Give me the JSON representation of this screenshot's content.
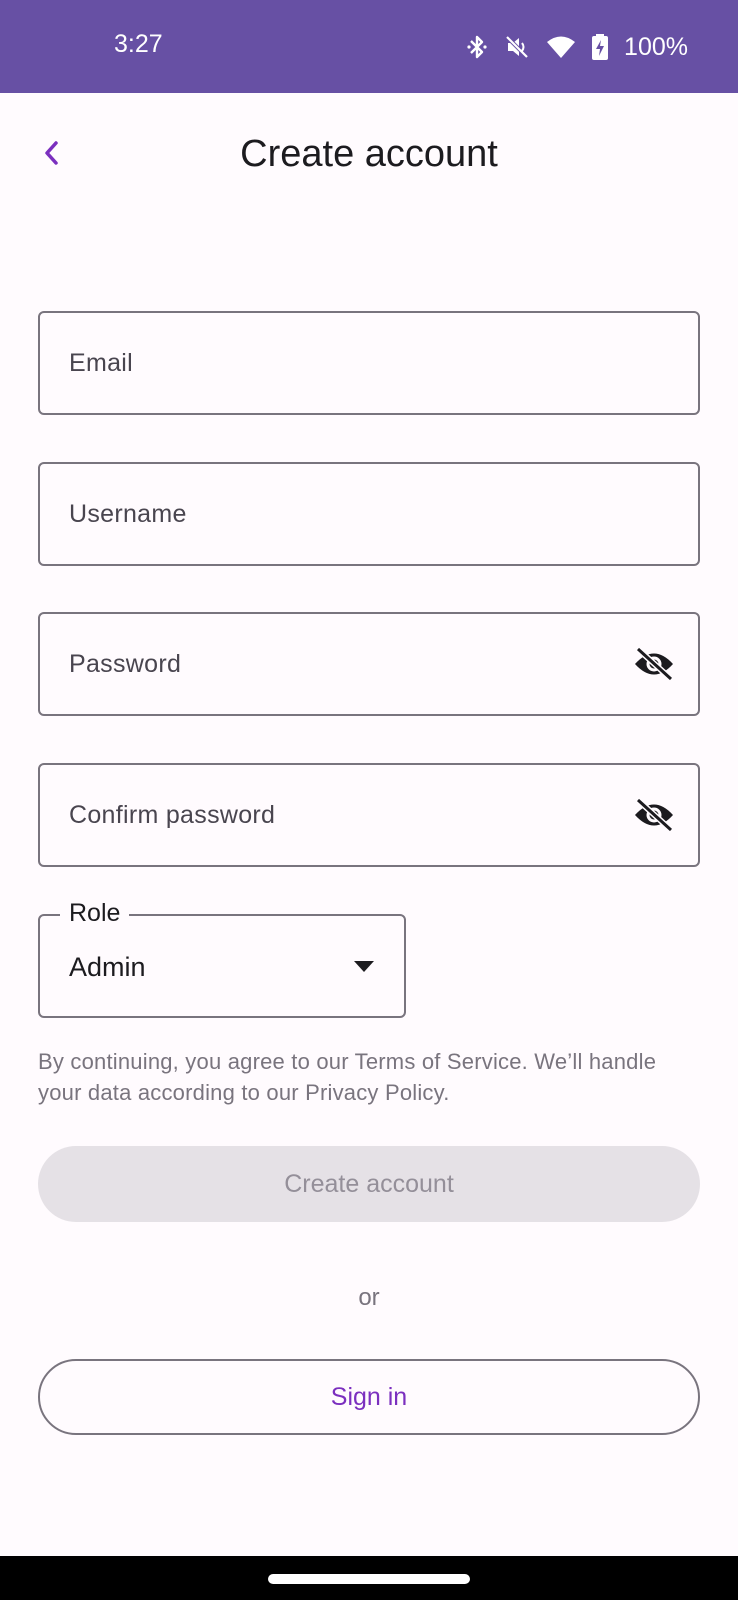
{
  "status_bar": {
    "time": "3:27",
    "battery": "100%",
    "icons": [
      "bluetooth-icon",
      "vibrate-off-icon",
      "wifi-icon",
      "battery-charging-icon"
    ]
  },
  "header": {
    "title": "Create account",
    "back_icon": "chevron-left-icon"
  },
  "form": {
    "email_placeholder": "Email",
    "username_placeholder": "Username",
    "password_placeholder": "Password",
    "confirm_password_placeholder": "Confirm password",
    "visibility_icon": "eye-off-icon",
    "role": {
      "label": "Role",
      "value": "Admin"
    }
  },
  "legal_text": "By continuing, you agree to our Terms of Service. We’ll handle your data according to our Privacy Policy.",
  "actions": {
    "create_label": "Create account",
    "or_label": "or",
    "signin_label": "Sign in"
  },
  "colors": {
    "status_bar": "#6750a4",
    "accent": "#7b2fbf",
    "background": "#fffbfe",
    "outline": "#79747e",
    "disabled_button": "#e5e1e6"
  }
}
